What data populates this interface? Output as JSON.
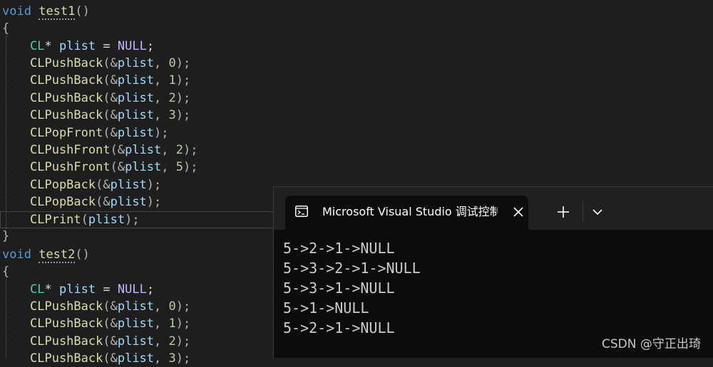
{
  "editor": {
    "test1": {
      "signature_type": "void",
      "signature_name": "test1",
      "signature_parens": "()",
      "open_brace": "{",
      "close_brace": "}",
      "decl": {
        "type": "CL",
        "star": "* ",
        "name": "plist",
        "op": " = ",
        "value": "NULL",
        "semi": ";"
      },
      "calls": [
        {
          "fn": "CLPushBack",
          "open": "(&",
          "arg": "plist",
          "rest": ", ",
          "num": "0",
          "close": ");"
        },
        {
          "fn": "CLPushBack",
          "open": "(&",
          "arg": "plist",
          "rest": ", ",
          "num": "1",
          "close": ");"
        },
        {
          "fn": "CLPushBack",
          "open": "(&",
          "arg": "plist",
          "rest": ", ",
          "num": "2",
          "close": ");"
        },
        {
          "fn": "CLPushBack",
          "open": "(&",
          "arg": "plist",
          "rest": ", ",
          "num": "3",
          "close": ");"
        },
        {
          "fn": "CLPopFront",
          "open": "(&",
          "arg": "plist",
          "rest": "",
          "num": "",
          "close": ");"
        },
        {
          "fn": "CLPushFront",
          "open": "(&",
          "arg": "plist",
          "rest": ", ",
          "num": "2",
          "close": ");"
        },
        {
          "fn": "CLPushFront",
          "open": "(&",
          "arg": "plist",
          "rest": ", ",
          "num": "5",
          "close": ");"
        },
        {
          "fn": "CLPopBack",
          "open": "(&",
          "arg": "plist",
          "rest": "",
          "num": "",
          "close": ");"
        },
        {
          "fn": "CLPopBack",
          "open": "(&",
          "arg": "plist",
          "rest": "",
          "num": "",
          "close": ");"
        },
        {
          "fn": "CLPrint",
          "open": "(",
          "arg": "plist",
          "rest": "",
          "num": "",
          "close": ");"
        }
      ]
    },
    "test2": {
      "signature_type": "void",
      "signature_name": "test2",
      "signature_parens": "()",
      "open_brace": "{",
      "decl": {
        "type": "CL",
        "star": "* ",
        "name": "plist",
        "op": " = ",
        "value": "NULL",
        "semi": ";"
      },
      "calls": [
        {
          "fn": "CLPushBack",
          "open": "(&",
          "arg": "plist",
          "rest": ", ",
          "num": "0",
          "close": ");"
        },
        {
          "fn": "CLPushBack",
          "open": "(&",
          "arg": "plist",
          "rest": ", ",
          "num": "1",
          "close": ");"
        },
        {
          "fn": "CLPushBack",
          "open": "(&",
          "arg": "plist",
          "rest": ", ",
          "num": "2",
          "close": ");"
        },
        {
          "fn": "CLPushBack",
          "open": "(&",
          "arg": "plist",
          "rest": ", ",
          "num": "3",
          "close": ");"
        }
      ]
    }
  },
  "terminal": {
    "tab_title": "Microsoft Visual Studio 调试控制台",
    "tab_icon": "console-icon",
    "close_icon": "close-icon",
    "new_tab_icon": "plus-icon",
    "dropdown_icon": "chevron-down-icon",
    "output": [
      "5->2->1->NULL",
      "5->3->2->1->NULL",
      "5->3->1->NULL",
      "5->1->NULL",
      "5->2->1->NULL"
    ]
  },
  "watermark": "CSDN @守正出琦",
  "colors": {
    "keyword": "#569cd6",
    "function": "#dcdcaa",
    "type": "#4ec9b0",
    "variable": "#9cdcfe",
    "number": "#b5cea8",
    "macro": "#beb7ff",
    "editor_bg": "#1e1e1e",
    "terminal_bg": "#0c0c0c"
  }
}
